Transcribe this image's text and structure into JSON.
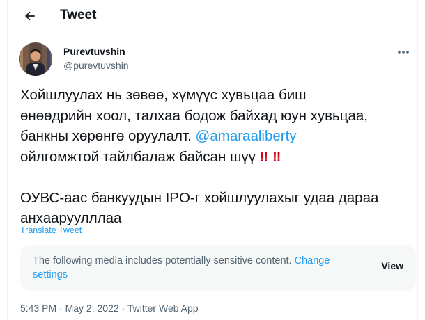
{
  "header": {
    "title": "Tweet"
  },
  "author": {
    "name": "Purevtuvshin",
    "handle": "@purevtuvshin"
  },
  "tweet": {
    "line1": "Хойшлуулах нь зөвөө, хүмүүс хувьцаа биш",
    "line2": "өнөөдрийн хоол, талхаа бодож байхад юун хувьцаа,",
    "line3": "банкны хөрөнгө оруулалт.",
    "mention": "@amaraaliberty",
    "line4": "ойлгомжтой тайлбалаж байсан шүү",
    "emoji1": "‼",
    "emoji2": "‼",
    "line5": "ОУВС-аас банкуудын IPO-г хойшлуулахыг удаа дараа",
    "line6": "анхааруулллаа"
  },
  "translate": "Translate Tweet",
  "sensitive": {
    "text": "The following media includes potentially sensitive content.",
    "link": "Change settings",
    "button": "View"
  },
  "meta": {
    "time": "5:43 PM",
    "sep1": "·",
    "date": "May 2, 2022",
    "sep2": "·",
    "source": "Twitter Web App"
  },
  "icons": {
    "back": "arrow-left-icon",
    "more": "more-horizontal-icon"
  },
  "colors": {
    "accent": "#1d9bf0",
    "muted": "#536471",
    "text": "#0f1419",
    "emoji": "#d0021b"
  }
}
